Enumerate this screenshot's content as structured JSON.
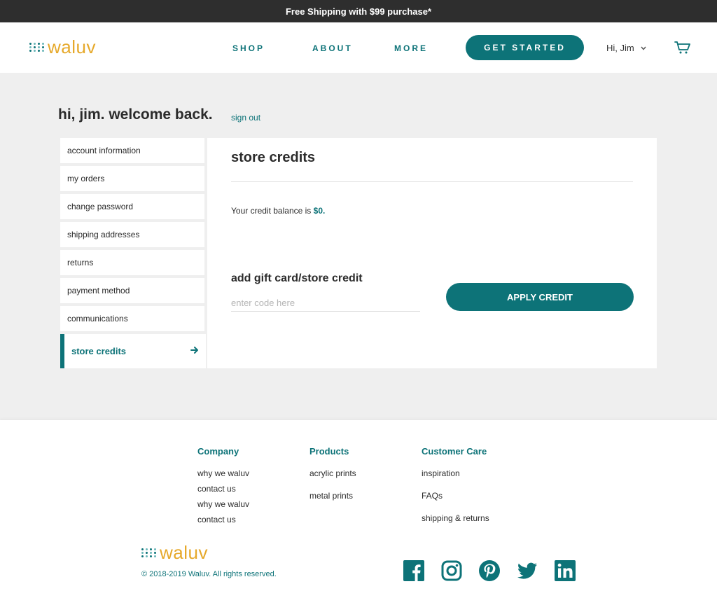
{
  "promo": {
    "text": "Free Shipping with $99 purchase*"
  },
  "header": {
    "logo": "waluv",
    "nav": [
      "SHOP",
      "ABOUT",
      "MORE"
    ],
    "cta": "GET STARTED",
    "user_greeting": "Hi, Jim",
    "cart_icon": "cart-icon"
  },
  "account": {
    "welcome": "hi, jim. welcome back.",
    "sign_out": "sign out",
    "sidebar": [
      "account information",
      "my orders",
      "change password",
      "shipping addresses",
      "returns",
      "payment method",
      "communications"
    ],
    "active_item": "store credits"
  },
  "panel": {
    "title": "store credits",
    "balance_prefix": "Your credit balance is ",
    "balance_amount": "$0",
    "balance_suffix": ".",
    "gift_title": "add gift card/store credit",
    "code_placeholder": "enter code here",
    "apply_label": "APPLY CREDIT"
  },
  "footer": {
    "columns": [
      {
        "heading": "Company",
        "links": [
          "why we waluv",
          "contact us",
          "why we waluv",
          "contact us"
        ]
      },
      {
        "heading": "Products",
        "links": [
          "acrylic prints",
          "metal prints"
        ]
      },
      {
        "heading": "Customer Care",
        "links": [
          "inspiration",
          "FAQs",
          "shipping & returns"
        ]
      }
    ],
    "logo": "waluv",
    "copyright": "© 2018-2019 Waluv. All rights reserved.",
    "social": [
      "facebook-icon",
      "instagram-icon",
      "pinterest-icon",
      "twitter-icon",
      "linkedin-icon"
    ]
  },
  "colors": {
    "brand": "#0d7378",
    "logo_text": "#e6a92b",
    "promo_bg": "#2e2e2e",
    "page_bg": "#efefef"
  }
}
